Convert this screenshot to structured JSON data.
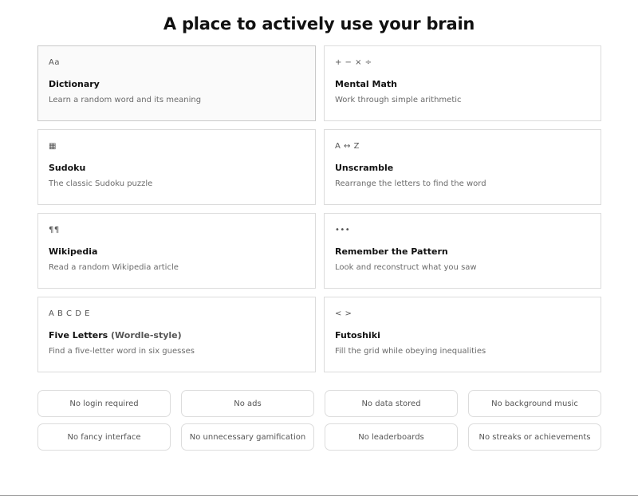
{
  "page": {
    "title": "A place to actively use your brain"
  },
  "cards": [
    {
      "icon": "Aa",
      "title": "Dictionary",
      "description": "Learn a random word and its meaning"
    },
    {
      "icon": "+ − × ÷",
      "title": "Mental Math",
      "description": "Work through simple arithmetic"
    },
    {
      "icon": "▦",
      "title": "Sudoku",
      "description": "The classic Sudoku puzzle"
    },
    {
      "icon": "A ↔ Z",
      "title": "Unscramble",
      "description": "Rearrange the letters to find the word"
    },
    {
      "icon": "¶¶",
      "title": "Wikipedia",
      "description": "Read a random Wikipedia article"
    },
    {
      "icon": "•••",
      "title": "Remember the Pattern",
      "description": "Look and reconstruct what you saw"
    },
    {
      "icon": "A B C D E",
      "title": "Five Letters",
      "title_suffix": "(Wordle-style)",
      "description": "Find a five-letter word in six guesses"
    },
    {
      "icon": "< >",
      "title": "Futoshiki",
      "description": "Fill the grid while obeying inequalities"
    }
  ],
  "features": [
    "No login required",
    "No ads",
    "No data stored",
    "No background music",
    "No fancy interface",
    "No unnecessary gamification",
    "No leaderboards",
    "No streaks or achievements"
  ]
}
